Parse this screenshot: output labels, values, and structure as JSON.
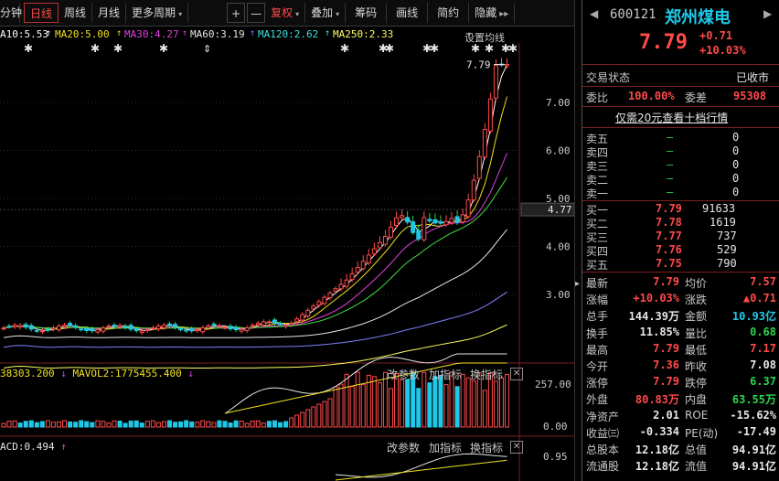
{
  "toolbar": {
    "items": [
      "分钟",
      "日线",
      "周线",
      "月线",
      "更多周期"
    ],
    "more_arrow": "▾",
    "plus": "+",
    "minus": "—",
    "fuquan": "复权",
    "diejia": "叠加",
    "chouma": "筹码",
    "huaxian": "画线",
    "jianyue": "简约",
    "yincang": "隐藏",
    "more": "▸▸"
  },
  "ma_row": {
    "ma10": "A10:5.53",
    "ma20": "MA20:5.00",
    "ma30": "MA30:4.27",
    "ma60": "MA60:3.19",
    "ma120": "MA120:2.62",
    "ma250": "MA250:2.33",
    "setting": "设置均线"
  },
  "price_axis": [
    "7.00",
    "6.00",
    "5.00",
    "4.00",
    "3.00"
  ],
  "current_price_tag": "4.77",
  "high_label": "7.79",
  "vol_panel": {
    "header": "38303.200",
    "mavol2": "MAVOL2:1775455.400",
    "axis_top": "257.00",
    "axis_bottom": "0.00",
    "tabs": [
      "改参数",
      "加指标",
      "换指标"
    ]
  },
  "macd_panel": {
    "header": "ACD:0.494",
    "axis_top": "0.95",
    "tabs": [
      "改参数",
      "加指标",
      "换指标"
    ]
  },
  "close_symbol": "✕",
  "stock": {
    "code": "600121",
    "name": "郑州煤电",
    "price": "7.79",
    "change": "+0.71",
    "change_pct": "+10.03%"
  },
  "status": {
    "label": "交易状态",
    "value": "已收市"
  },
  "weibi": {
    "label": "委比",
    "value": "100.00%",
    "label2": "委差",
    "value2": "95308"
  },
  "level10_link": "仅需20元查看十档行情",
  "asks": [
    {
      "label": "卖五",
      "price": "—",
      "vol": "0"
    },
    {
      "label": "卖四",
      "price": "—",
      "vol": "0"
    },
    {
      "label": "卖三",
      "price": "—",
      "vol": "0"
    },
    {
      "label": "卖二",
      "price": "—",
      "vol": "0"
    },
    {
      "label": "卖一",
      "price": "—",
      "vol": "0"
    }
  ],
  "bids": [
    {
      "label": "买一",
      "price": "7.79",
      "vol": "91633"
    },
    {
      "label": "买二",
      "price": "7.78",
      "vol": "1619"
    },
    {
      "label": "买三",
      "price": "7.77",
      "vol": "737"
    },
    {
      "label": "买四",
      "price": "7.76",
      "vol": "529"
    },
    {
      "label": "买五",
      "price": "7.75",
      "vol": "790"
    }
  ],
  "stats": [
    {
      "l1": "最新",
      "v1": "7.79",
      "c1": "up",
      "l2": "均价",
      "v2": "7.57",
      "c2": "up"
    },
    {
      "l1": "涨幅",
      "v1": "+10.03%",
      "c1": "up",
      "l2": "涨跌",
      "v2": "▲0.71",
      "c2": "up"
    },
    {
      "l1": "总手",
      "v1": "144.39万",
      "c1": "wh",
      "l2": "金额",
      "v2": "10.93亿",
      "c2": "cy"
    },
    {
      "l1": "换手",
      "v1": "11.85%",
      "c1": "wh",
      "l2": "量比",
      "v2": "0.68",
      "c2": "dn"
    },
    {
      "l1": "最高",
      "v1": "7.79",
      "c1": "up",
      "l2": "最低",
      "v2": "7.17",
      "c2": "up"
    },
    {
      "l1": "今开",
      "v1": "7.36",
      "c1": "up",
      "l2": "昨收",
      "v2": "7.08",
      "c2": "wh"
    },
    {
      "l1": "涨停",
      "v1": "7.79",
      "c1": "up",
      "l2": "跌停",
      "v2": "6.37",
      "c2": "dn"
    },
    {
      "l1": "外盘",
      "v1": "80.83万",
      "c1": "up",
      "l2": "内盘",
      "v2": "63.55万",
      "c2": "dn"
    },
    {
      "l1": "净资产",
      "v1": "2.01",
      "c1": "wh",
      "l2": "ROE",
      "v2": "-15.62%",
      "c2": "wh"
    },
    {
      "l1": "收益㈢",
      "v1": "-0.334",
      "c1": "wh",
      "l2": "PE(动)",
      "v2": "-17.49",
      "c2": "wh"
    },
    {
      "l1": "总股本",
      "v1": "12.18亿",
      "c1": "wh",
      "l2": "总值",
      "v2": "94.91亿",
      "c2": "wh"
    },
    {
      "l1": "流通股",
      "v1": "12.18亿",
      "c1": "wh",
      "l2": "流值",
      "v2": "94.91亿",
      "c2": "wh"
    }
  ],
  "colors": {
    "up": "#ff4a4a",
    "down": "#2ad44f",
    "ma10": "#ffffff",
    "ma20": "#f0e020",
    "ma30": "#e040e0",
    "ma60": "#40e040",
    "ma120": "#8080ff",
    "ma250": "#ffff60"
  }
}
